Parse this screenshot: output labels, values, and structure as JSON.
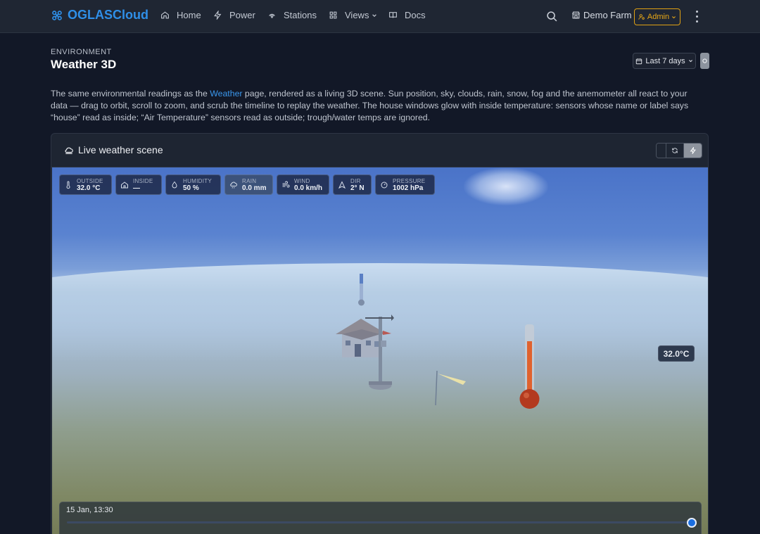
{
  "nav": {
    "brand": "OGLASCloud",
    "items": [
      {
        "label": "Home",
        "icon": "home-icon"
      },
      {
        "label": "Power",
        "icon": "bolt-icon"
      },
      {
        "label": "Stations",
        "icon": "antenna-icon"
      },
      {
        "label": "Views",
        "icon": "grid-icon"
      },
      {
        "label": "Docs",
        "icon": "book-icon"
      }
    ],
    "farm": "Demo Farm",
    "admin": "Admin"
  },
  "header": {
    "eyebrow": "ENVIRONMENT",
    "title": "Weather 3D",
    "range": "Last 7 days"
  },
  "description": {
    "before": "The same environmental readings as the ",
    "link": "Weather",
    "after": " page, rendered as a living 3D scene. Sun position, sky, clouds, rain, snow, fog and the anemometer all react to your data — drag to orbit, scroll to zoom, and scrub the timeline to replay the weather. The house windows glow with inside temperature: sensors whose name or label says “house” read as inside; “Air Temperature” sensors read as outside; trough/water temps are ignored."
  },
  "card": {
    "title": "Live weather scene"
  },
  "chips": [
    {
      "label": "OUTSIDE",
      "value": "32.0 °C",
      "icon": "thermometer-icon"
    },
    {
      "label": "INSIDE",
      "value": "—",
      "icon": "house-icon"
    },
    {
      "label": "HUMIDITY",
      "value": "50 %",
      "icon": "droplet-icon"
    },
    {
      "label": "RAIN",
      "value": "0.0 mm",
      "icon": "cloud-rain-icon"
    },
    {
      "label": "WIND",
      "value": "0.0 km/h",
      "icon": "wind-icon"
    },
    {
      "label": "DIR",
      "value": "2° N",
      "icon": "compass-arrow-icon"
    },
    {
      "label": "PRESSURE",
      "value": "1002 hPa",
      "icon": "gauge-icon"
    }
  ],
  "scene": {
    "temp_badge": "32.0°C",
    "timeline_label": "15 Jan, 13:30",
    "timeline_position": 1.0
  }
}
